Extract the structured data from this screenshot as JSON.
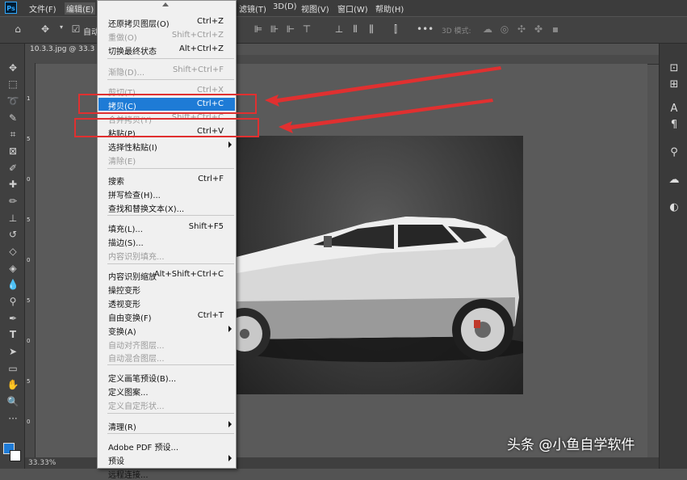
{
  "app": {
    "logo": "Ps"
  },
  "menubar": {
    "items": [
      "文件(F)",
      "编辑(E)",
      "滤镜(T)",
      "3D(D)",
      "视图(V)",
      "窗口(W)",
      "帮助(H)"
    ]
  },
  "options_bar": {
    "auto_select_label": "自动",
    "mode_3d_label": "3D 模式:"
  },
  "document": {
    "tab_title": "10.3.3.jpg @ 33.3",
    "zoom": "33.33%"
  },
  "ruler": {
    "left_marks": [
      "1",
      "5",
      "0",
      "5",
      "0",
      "5",
      "0",
      "5",
      "0"
    ]
  },
  "edit_menu": {
    "items": [
      {
        "label": "还原拷贝图层(O)",
        "shortcut": "Ctrl+Z",
        "disabled": false
      },
      {
        "label": "重做(O)",
        "shortcut": "Shift+Ctrl+Z",
        "disabled": true
      },
      {
        "label": "切换最终状态",
        "shortcut": "Alt+Ctrl+Z",
        "disabled": false
      },
      {
        "label": "渐隐(D)...",
        "shortcut": "Shift+Ctrl+F",
        "disabled": true
      },
      {
        "label": "剪切(T)",
        "shortcut": "Ctrl+X",
        "disabled": true
      },
      {
        "label": "拷贝(C)",
        "shortcut": "Ctrl+C",
        "disabled": false,
        "highlighted": true
      },
      {
        "label": "合并拷贝(Y)",
        "shortcut": "Shift+Ctrl+C",
        "disabled": true
      },
      {
        "label": "粘贴(P)",
        "shortcut": "Ctrl+V",
        "disabled": false
      },
      {
        "label": "选择性粘贴(I)",
        "shortcut": "",
        "disabled": false,
        "submenu": true
      },
      {
        "label": "清除(E)",
        "shortcut": "",
        "disabled": true
      },
      {
        "label": "搜索",
        "shortcut": "Ctrl+F",
        "disabled": false
      },
      {
        "label": "拼写检查(H)...",
        "shortcut": "",
        "disabled": false
      },
      {
        "label": "查找和替换文本(X)...",
        "shortcut": "",
        "disabled": false
      },
      {
        "label": "填充(L)...",
        "shortcut": "Shift+F5",
        "disabled": false
      },
      {
        "label": "描边(S)...",
        "shortcut": "",
        "disabled": false
      },
      {
        "label": "内容识别填充...",
        "shortcut": "",
        "disabled": true
      },
      {
        "label": "内容识别缩放",
        "shortcut": "Alt+Shift+Ctrl+C",
        "disabled": false
      },
      {
        "label": "操控变形",
        "shortcut": "",
        "disabled": false
      },
      {
        "label": "透视变形",
        "shortcut": "",
        "disabled": false
      },
      {
        "label": "自由变换(F)",
        "shortcut": "Ctrl+T",
        "disabled": false
      },
      {
        "label": "变换(A)",
        "shortcut": "",
        "disabled": false,
        "submenu": true
      },
      {
        "label": "自动对齐图层...",
        "shortcut": "",
        "disabled": true
      },
      {
        "label": "自动混合图层...",
        "shortcut": "",
        "disabled": true
      },
      {
        "label": "定义画笔预设(B)...",
        "shortcut": "",
        "disabled": false
      },
      {
        "label": "定义图案...",
        "shortcut": "",
        "disabled": false
      },
      {
        "label": "定义自定形状...",
        "shortcut": "",
        "disabled": true
      },
      {
        "label": "清理(R)",
        "shortcut": "",
        "disabled": false,
        "submenu": true
      },
      {
        "label": "Adobe PDF 预设...",
        "shortcut": "",
        "disabled": false
      },
      {
        "label": "预设",
        "shortcut": "",
        "disabled": false,
        "submenu": true
      },
      {
        "label": "远程连接...",
        "shortcut": "",
        "disabled": false
      }
    ]
  },
  "watermark": {
    "text": "头条 @小鱼自学软件"
  },
  "colors": {
    "highlight": "#1e7bd6",
    "annotation_red": "#e03030"
  }
}
